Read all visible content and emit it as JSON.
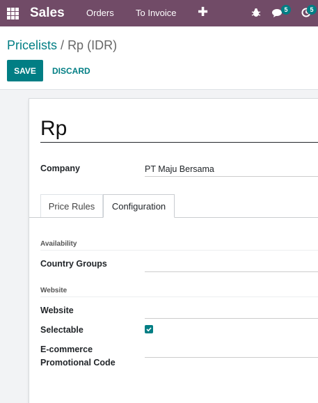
{
  "navbar": {
    "brand": "Sales",
    "menu": [
      "Orders",
      "To Invoice"
    ],
    "plus": "✚",
    "messages_count": "5",
    "activities_count": "5"
  },
  "breadcrumb": {
    "parent": "Pricelists",
    "separator": "/",
    "current": "Rp (IDR)"
  },
  "buttons": {
    "save": "SAVE",
    "discard": "DISCARD"
  },
  "form": {
    "name": "Rp",
    "company_label": "Company",
    "company_value": "PT Maju Bersama",
    "tabs": [
      "Price Rules",
      "Configuration"
    ],
    "active_tab": "Configuration",
    "availability_section": "Availability",
    "country_groups_label": "Country Groups",
    "website_section": "Website",
    "website_label": "Website",
    "selectable_label": "Selectable",
    "selectable_checked": true,
    "ecommerce_label_1": "E-commerce",
    "ecommerce_label_2": "Promotional Code"
  },
  "colors": {
    "navbar": "#714b67",
    "accent": "#017e84"
  }
}
